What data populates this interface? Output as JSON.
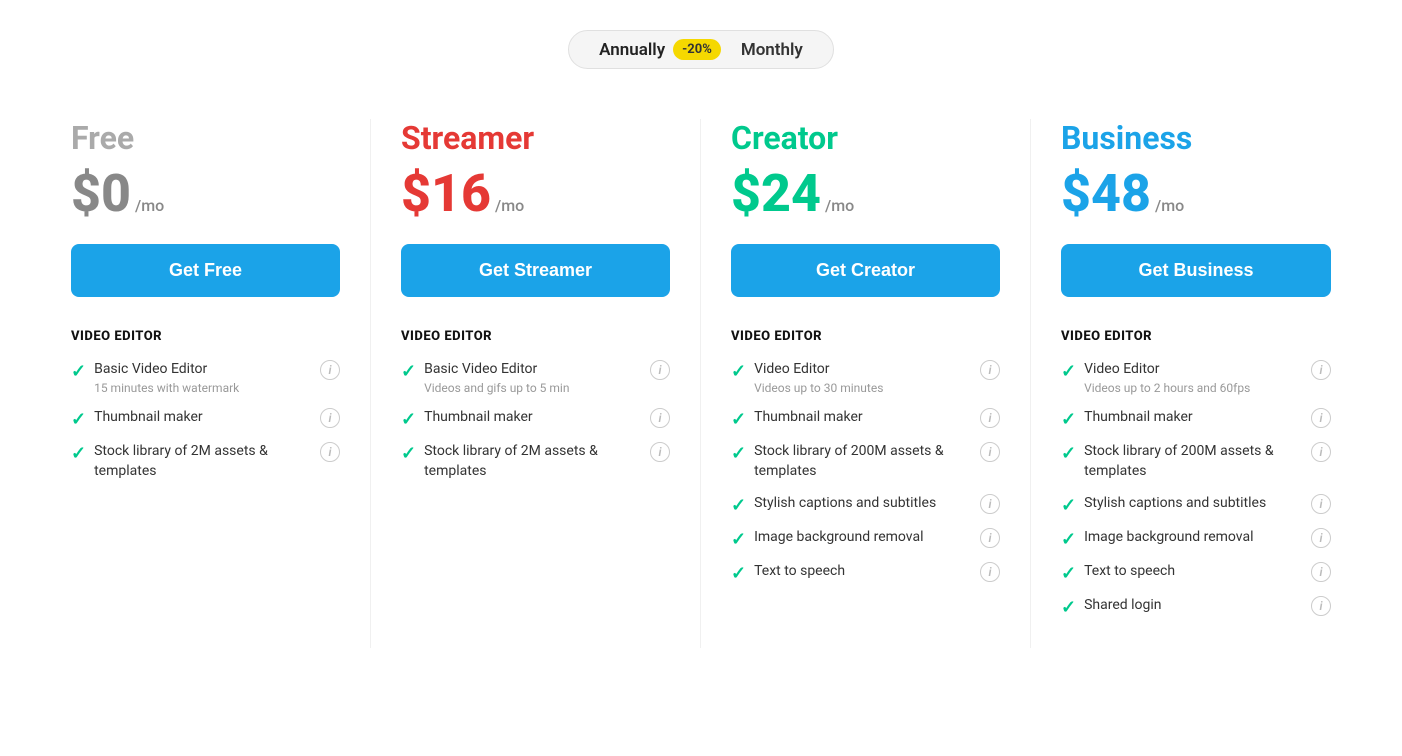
{
  "billing": {
    "annually_label": "Annually",
    "discount_badge": "-20%",
    "monthly_label": "Monthly",
    "active": "annually"
  },
  "plans": [
    {
      "id": "free",
      "name": "Free",
      "price": "$0",
      "period": "/mo",
      "button_label": "Get Free",
      "color_class": "free",
      "section_title": "VIDEO EDITOR",
      "features": [
        {
          "label": "Basic Video Editor",
          "sub": "15 minutes with watermark"
        },
        {
          "label": "Thumbnail maker",
          "sub": ""
        },
        {
          "label": "Stock library of 2M assets & templates",
          "sub": ""
        }
      ]
    },
    {
      "id": "streamer",
      "name": "Streamer",
      "price": "$16",
      "period": "/mo",
      "button_label": "Get Streamer",
      "color_class": "streamer",
      "section_title": "VIDEO EDITOR",
      "features": [
        {
          "label": "Basic Video Editor",
          "sub": "Videos and gifs up to 5 min"
        },
        {
          "label": "Thumbnail maker",
          "sub": ""
        },
        {
          "label": "Stock library of 2M assets & templates",
          "sub": ""
        }
      ]
    },
    {
      "id": "creator",
      "name": "Creator",
      "price": "$24",
      "period": "/mo",
      "button_label": "Get Creator",
      "color_class": "creator",
      "section_title": "VIDEO EDITOR",
      "features": [
        {
          "label": "Video Editor",
          "sub": "Videos up to 30 minutes"
        },
        {
          "label": "Thumbnail maker",
          "sub": ""
        },
        {
          "label": "Stock library of 200M assets & templates",
          "sub": ""
        },
        {
          "label": "Stylish captions and subtitles",
          "sub": ""
        },
        {
          "label": "Image background removal",
          "sub": ""
        },
        {
          "label": "Text to speech",
          "sub": ""
        }
      ]
    },
    {
      "id": "business",
      "name": "Business",
      "price": "$48",
      "period": "/mo",
      "button_label": "Get Business",
      "color_class": "business",
      "section_title": "VIDEO EDITOR",
      "features": [
        {
          "label": "Video Editor",
          "sub": "Videos up to 2 hours and 60fps"
        },
        {
          "label": "Thumbnail maker",
          "sub": ""
        },
        {
          "label": "Stock library of 200M assets & templates",
          "sub": ""
        },
        {
          "label": "Stylish captions and subtitles",
          "sub": ""
        },
        {
          "label": "Image background removal",
          "sub": ""
        },
        {
          "label": "Text to speech",
          "sub": ""
        },
        {
          "label": "Shared login",
          "sub": ""
        }
      ]
    }
  ]
}
